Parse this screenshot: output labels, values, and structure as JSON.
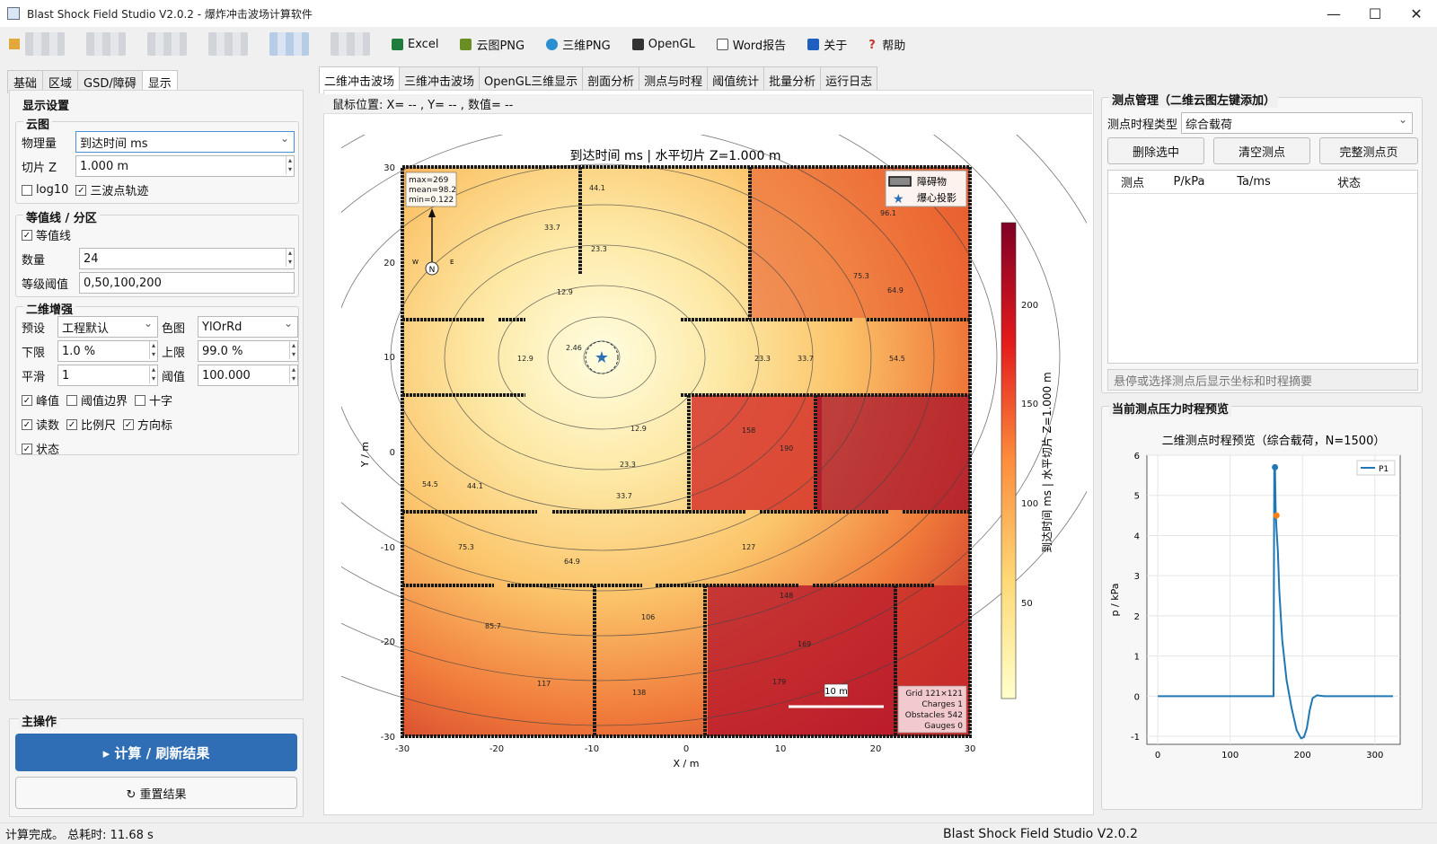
{
  "window": {
    "title": "Blast Shock Field Studio V2.0.2 - 爆炸冲击波场计算软件",
    "controls": [
      "—",
      "☐",
      "✕"
    ]
  },
  "toolbar": {
    "buttons": [
      {
        "label": "Excel",
        "icon": "excel-icon",
        "color": "#1e7d3c"
      },
      {
        "label": "云图PNG",
        "icon": "image-icon",
        "color": "#6b8e23"
      },
      {
        "label": "三维PNG",
        "icon": "globe-icon",
        "color": "#2a8fd0"
      },
      {
        "label": "OpenGL",
        "icon": "monitor-icon",
        "color": "#333333"
      },
      {
        "label": "Word报告",
        "icon": "document-icon",
        "color": "#555555"
      },
      {
        "label": "关于",
        "icon": "info-icon",
        "color": "#1f5fbf"
      },
      {
        "label": "帮助",
        "icon": "help-icon",
        "color": "#c0392b"
      }
    ]
  },
  "left_tabs": [
    "基础",
    "区域",
    "GSD/障碍",
    "显示"
  ],
  "left_active_tab": "显示",
  "display_settings": {
    "title": "显示设置",
    "cloud": {
      "title": "云图",
      "quantity_label": "物理量",
      "quantity_value": "到达时间 ms",
      "slice_label": "切片 Z",
      "slice_value": "1.000 m",
      "log10_label": "log10",
      "log10_checked": false,
      "triple_label": "三波点轨迹",
      "triple_checked": true
    },
    "contour": {
      "title": "等值线 / 分区",
      "contour_label": "等值线",
      "contour_checked": true,
      "count_label": "数量",
      "count_value": "24",
      "levels_label": "等级阈值",
      "levels_value": "0,50,100,200"
    },
    "enhance": {
      "title": "二维增强",
      "preset_label": "预设",
      "preset_value": "工程默认",
      "cmap_label": "色图",
      "cmap_value": "YlOrRd",
      "lower_label": "下限",
      "lower_value": "1.0 %",
      "upper_label": "上限",
      "upper_value": "99.0 %",
      "smooth_label": "平滑",
      "smooth_value": "1",
      "thresh_label": "阈值",
      "thresh_value": "100.000",
      "checks": [
        {
          "label": "峰值",
          "checked": true
        },
        {
          "label": "阈值边界",
          "checked": false
        },
        {
          "label": "十字",
          "checked": false
        },
        {
          "label": "读数",
          "checked": true
        },
        {
          "label": "比例尺",
          "checked": true
        },
        {
          "label": "方向标",
          "checked": true
        },
        {
          "label": "状态",
          "checked": true
        }
      ]
    }
  },
  "main_ops": {
    "title": "主操作",
    "compute_label": "▸  计算 / 刷新结果",
    "reset_label": "↻  重置结果"
  },
  "center_tabs": [
    "二维冲击波场",
    "三维冲击波场",
    "OpenGL三维显示",
    "剖面分析",
    "测点与时程",
    "阈值统计",
    "批量分析",
    "运行日志"
  ],
  "center_active_tab": "二维冲击波场",
  "mouse_readout": "鼠标位置: X= -- , Y= -- , 数值= --",
  "plot": {
    "title": "到达时间 ms   |   水平切片 Z=1.000 m",
    "xlabel": "X / m",
    "ylabel": "Y / m",
    "colorbar_label": "到达时间 ms  |  水平切片 Z=1.000 m",
    "x_ticks": [
      "-30",
      "-20",
      "-10",
      "0",
      "10",
      "20",
      "30"
    ],
    "y_ticks": [
      "30",
      "20",
      "10",
      "0",
      "-10",
      "-20",
      "-30"
    ],
    "cbar_ticks": [
      "200",
      "150",
      "100",
      "50"
    ],
    "stats": [
      "max=269",
      "mean=98.2",
      "min=0.122"
    ],
    "legend": [
      "障碍物",
      "爆心投影"
    ],
    "compass": {
      "n": "N",
      "w": "W",
      "e": "E"
    },
    "scalebar": "10 m",
    "info": [
      "Grid 121×121",
      "Charges 1",
      "Obstacles 542",
      "Gauges 0"
    ],
    "contour_labels": [
      "44.1",
      "33.7",
      "23.3",
      "12.9",
      "2.46",
      "12.9",
      "23.3",
      "33.7",
      "44.1",
      "54.5",
      "64.9",
      "12.9",
      "23.3",
      "33.7",
      "54.5",
      "75.3",
      "85.7",
      "106",
      "117",
      "127",
      "138",
      "148",
      "158",
      "179",
      "190",
      "169",
      "96.1",
      "64.9",
      "75.3"
    ]
  },
  "chart_data": {
    "type": "line",
    "title": "二维测点时程预览（综合载荷，N=1500）",
    "xlabel": "",
    "ylabel": "p / kPa",
    "xlim": [
      -15,
      335
    ],
    "ylim": [
      -1.2,
      6
    ],
    "x_ticks": [
      0,
      100,
      200,
      300
    ],
    "y_ticks": [
      6,
      5,
      4,
      3,
      2,
      1,
      0,
      -1
    ],
    "series": [
      {
        "name": "P1",
        "color": "#1f77b4",
        "x": [
          0,
          160,
          161,
          162,
          163,
          164,
          166,
          168,
          172,
          178,
          185,
          192,
          198,
          202,
          206,
          210,
          214,
          220,
          230,
          260,
          300,
          325
        ],
        "y": [
          0,
          0,
          5.6,
          5.7,
          4.6,
          4.2,
          3.6,
          2.6,
          1.4,
          0.4,
          -0.3,
          -0.85,
          -1.05,
          -1.02,
          -0.8,
          -0.35,
          -0.05,
          0.02,
          0,
          0,
          0,
          0
        ]
      }
    ],
    "markers": [
      {
        "x": 162,
        "y": 5.7,
        "color": "#1f77b4"
      },
      {
        "x": 164,
        "y": 4.5,
        "color": "#ff7f0e"
      }
    ],
    "grid": true,
    "legend_position": "top-right"
  },
  "gauges": {
    "title": "测点管理（二维云图左键添加）",
    "type_label": "测点时程类型",
    "type_value": "综合载荷",
    "delete_label": "删除选中",
    "clear_label": "清空测点",
    "full_label": "完整测点页",
    "columns": [
      "测点",
      "P/kPa",
      "Ta/ms",
      "状态"
    ],
    "hint": "悬停或选择测点后显示坐标和时程摘要"
  },
  "preview_title": "当前测点压力时程预览",
  "status": {
    "left": "计算完成。 总耗时: 11.68 s",
    "right": "Blast Shock Field Studio V2.0.2"
  },
  "colors": {
    "accent": "#2f6db5",
    "line": "#1f77b4",
    "marker_orange": "#ff7f0e"
  }
}
